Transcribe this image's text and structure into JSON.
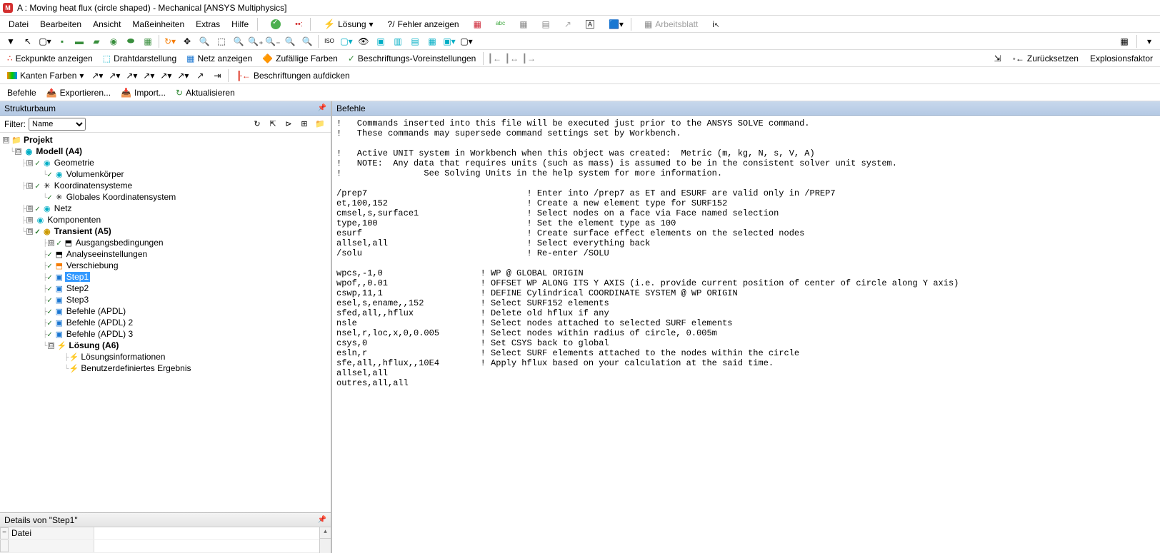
{
  "title": "A : Moving heat flux (circle shaped) - Mechanical [ANSYS Multiphysics]",
  "app_icon": "M",
  "menu": {
    "datei": "Datei",
    "bearbeiten": "Bearbeiten",
    "ansicht": "Ansicht",
    "masseinheiten": "Maßeinheiten",
    "extras": "Extras",
    "hilfe": "Hilfe",
    "loesung": "Lösung",
    "fehler": "Fehler anzeigen",
    "arbeitsblatt": "Arbeitsblatt"
  },
  "toolbar2": {
    "eckpunkte": "Eckpunkte anzeigen",
    "draht": "Drahtdarstellung",
    "netz": "Netz anzeigen",
    "farben": "Zufällige Farben",
    "beschriftung": "Beschriftungs-Voreinstellungen",
    "zuruecksetzen": "Zurücksetzen",
    "explosion": "Explosionsfaktor"
  },
  "toolbar3": {
    "kanten": "Kanten Farben",
    "aufdicken": "Beschriftungen aufdicken"
  },
  "toolbar4": {
    "befehle": "Befehle",
    "export": "Exportieren...",
    "import": "Import...",
    "aktual": "Aktualisieren"
  },
  "left": {
    "header": "Strukturbaum",
    "filter": "Filter:",
    "filter_val": "Name"
  },
  "tree": {
    "projekt": "Projekt",
    "modell": "Modell (A4)",
    "geometrie": "Geometrie",
    "volumen": "Volumenkörper",
    "koordsys": "Koordinatensysteme",
    "global": "Globales Koordinatensystem",
    "netz": "Netz",
    "komponenten": "Komponenten",
    "transient": "Transient (A5)",
    "ausgang": "Ausgangsbedingungen",
    "analyse": "Analyseeinstellungen",
    "verschiebung": "Verschiebung",
    "step1": "Step1",
    "step2": "Step2",
    "step3": "Step3",
    "befehle1": "Befehle (APDL)",
    "befehle2": "Befehle (APDL) 2",
    "befehle3": "Befehle (APDL) 3",
    "loesung": "Lösung (A6)",
    "loesinfo": "Lösungsinformationen",
    "benutzer": "Benutzerdefiniertes Ergebnis"
  },
  "details": {
    "header": "Details von \"Step1\"",
    "datei": "Datei"
  },
  "right": {
    "header": "Befehle"
  },
  "code": "!   Commands inserted into this file will be executed just prior to the ANSYS SOLVE command.\n!   These commands may supersede command settings set by Workbench.\n\n!   Active UNIT system in Workbench when this object was created:  Metric (m, kg, N, s, V, A)\n!   NOTE:  Any data that requires units (such as mass) is assumed to be in the consistent solver unit system.\n!                See Solving Units in the help system for more information.\n\n/prep7                               ! Enter into /prep7 as ET and ESURF are valid only in /PREP7\net,100,152                           ! Create a new element type for SURF152\ncmsel,s,surface1                     ! Select nodes on a face via Face named selection\ntype,100                             ! Set the element type as 100\nesurf                                ! Create surface effect elements on the selected nodes\nallsel,all                           ! Select everything back\n/solu                                ! Re-enter /SOLU\n\nwpcs,-1,0                   ! WP @ GLOBAL ORIGIN\nwpof,,0.01                  ! OFFSET WP ALONG ITS Y AXIS (i.e. provide current position of center of circle along Y axis)\ncswp,11,1                   ! DEFINE Cylindrical COORDINATE SYSTEM @ WP ORIGIN\nesel,s,ename,,152           ! Select SURF152 elements\nsfed,all,,hflux             ! Delete old hflux if any\nnsle                        ! Select nodes attached to selected SURF elements\nnsel,r,loc,x,0,0.005        ! Select nodes within radius of circle, 0.005m\ncsys,0                      ! Set CSYS back to global\nesln,r                      ! Select SURF elements attached to the nodes within the circle\nsfe,all,,hflux,,10E4        ! Apply hflux based on your calculation at the said time.\nallsel,all\noutres,all,all"
}
